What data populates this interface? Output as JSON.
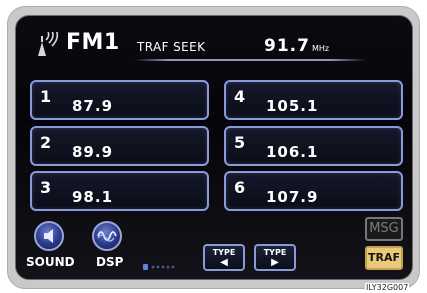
{
  "header": {
    "band": "FM1",
    "mode": "TRAF SEEK",
    "frequency": "91.7",
    "unit": "MHz"
  },
  "presets": [
    {
      "number": "1",
      "frequency": "87.9"
    },
    {
      "number": "2",
      "frequency": "89.9"
    },
    {
      "number": "3",
      "frequency": "98.1"
    },
    {
      "number": "4",
      "frequency": "105.1"
    },
    {
      "number": "5",
      "frequency": "106.1"
    },
    {
      "number": "6",
      "frequency": "107.9"
    }
  ],
  "controls": {
    "sound_label": "SOUND",
    "dsp_label": "DSP",
    "type_label": "TYPE",
    "type_prev_arrow": "◀",
    "type_next_arrow": "▶",
    "msg_label": "MSG",
    "traf_label": "TRAF"
  },
  "image_code": "ILY32G007",
  "colors": {
    "screen": "#07070c",
    "button_border": "#8a9ad8",
    "traf_active": "#e8c97d",
    "msg_inactive": "#7c7c7c"
  }
}
